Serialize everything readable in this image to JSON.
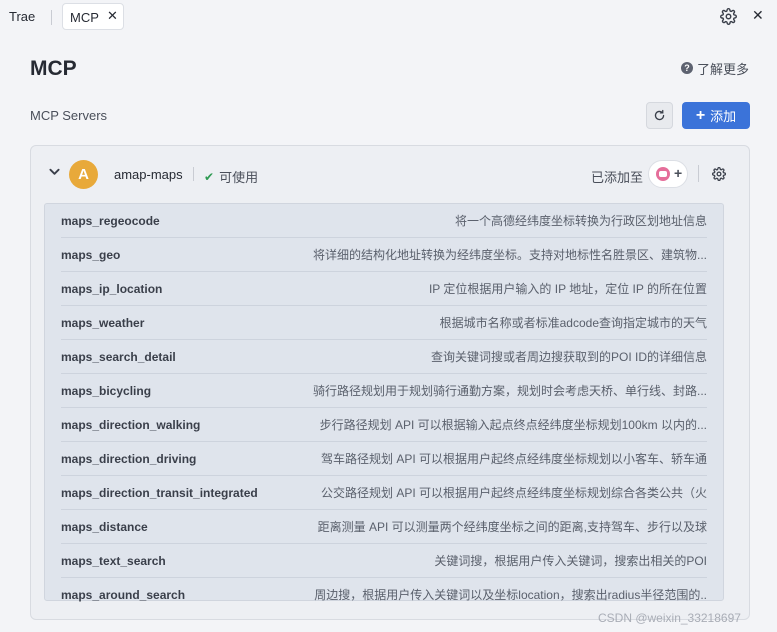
{
  "tabs": [
    {
      "label": "Trae"
    },
    {
      "label": "MCP",
      "close": "✕"
    }
  ],
  "window": {
    "close": "✕"
  },
  "header": {
    "title": "MCP",
    "learn_more": "了解更多",
    "help_glyph": "?"
  },
  "servers_section": {
    "title": "MCP Servers",
    "add_label": "添加",
    "add_glyph": "+"
  },
  "server": {
    "avatar_letter": "A",
    "avatar_color": "#e8a93a",
    "name": "amap-maps",
    "status": "可使用",
    "status_glyph": "✔",
    "status_color": "#2e9a52",
    "added_to_label": "已添加至",
    "added_plus": "+"
  },
  "tools": [
    {
      "name": "maps_regeocode",
      "description": "将一个高德经纬度坐标转换为行政区划地址信息"
    },
    {
      "name": "maps_geo",
      "description": "将详细的结构化地址转换为经纬度坐标。支持对地标性名胜景区、建筑物..."
    },
    {
      "name": "maps_ip_location",
      "description": "IP 定位根据用户输入的 IP 地址，定位 IP 的所在位置"
    },
    {
      "name": "maps_weather",
      "description": "根据城市名称或者标准adcode查询指定城市的天气"
    },
    {
      "name": "maps_search_detail",
      "description": "查询关键词搜或者周边搜获取到的POI ID的详细信息"
    },
    {
      "name": "maps_bicycling",
      "description": "骑行路径规划用于规划骑行通勤方案，规划时会考虑天桥、单行线、封路..."
    },
    {
      "name": "maps_direction_walking",
      "description": "步行路径规划 API 可以根据输入起点终点经纬度坐标规划100km 以内的..."
    },
    {
      "name": "maps_direction_driving",
      "description": "驾车路径规划 API 可以根据用户起终点经纬度坐标规划以小客车、轿车通"
    },
    {
      "name": "maps_direction_transit_integrated",
      "description": "公交路径规划 API 可以根据用户起终点经纬度坐标规划综合各类公共（火"
    },
    {
      "name": "maps_distance",
      "description": "距离测量 API 可以测量两个经纬度坐标之间的距离,支持驾车、步行以及球"
    },
    {
      "name": "maps_text_search",
      "description": "关键词搜，根据用户传入关键词，搜索出相关的POI"
    },
    {
      "name": "maps_around_search",
      "description": "周边搜，根据用户传入关键词以及坐标location，搜索出radius半径范围的.."
    }
  ],
  "watermark": "CSDN @weixin_33218697",
  "colors": {
    "accent": "#3b73d9",
    "background": "#f3f4f7",
    "tools_background": "#dfe4ec"
  }
}
